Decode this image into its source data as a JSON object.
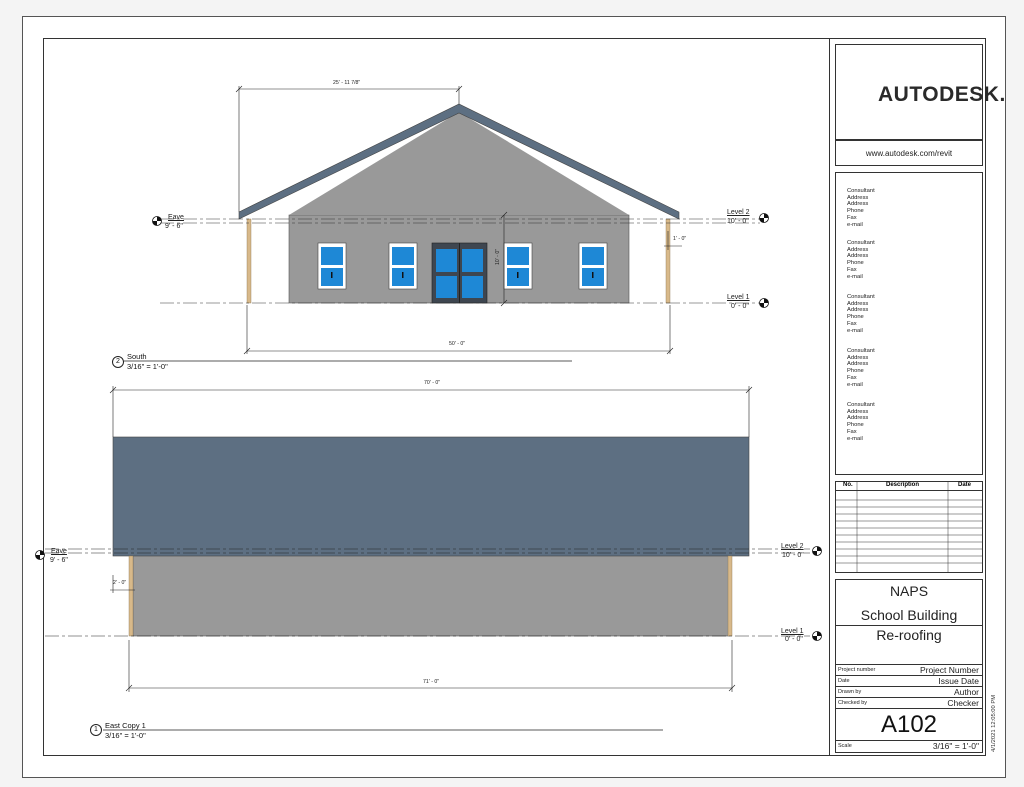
{
  "titleblock": {
    "logo_text": "AUTODESK.",
    "url": "www.autodesk.com/revit",
    "consultants": [
      [
        "Consultant",
        "Address",
        "Address",
        "Phone",
        "Fax",
        "e-mail"
      ],
      [
        "Consultant",
        "Address",
        "Address",
        "Phone",
        "Fax",
        "e-mail"
      ],
      [
        "Consultant",
        "Address",
        "Address",
        "Phone",
        "Fax",
        "e-mail"
      ],
      [
        "Consultant",
        "Address",
        "Address",
        "Phone",
        "Fax",
        "e-mail"
      ],
      [
        "Consultant",
        "Address",
        "Address",
        "Phone",
        "Fax",
        "e-mail"
      ]
    ],
    "revision_headers": {
      "no": "No.",
      "description": "Description",
      "date": "Date"
    },
    "project_client": "NAPS",
    "project_name_1": "School Building",
    "project_name_2": "Re-roofing",
    "meta": {
      "project_number_label": "Project number",
      "project_number": "Project Number",
      "date_label": "Date",
      "date": "Issue Date",
      "drawn_by_label": "Drawn by",
      "drawn_by": "Author",
      "checked_by_label": "Checked by",
      "checked_by": "Checker"
    },
    "sheet_number": "A102",
    "scale_label": "Scale",
    "scale": "3/16\" = 1'-0\"",
    "timestamp": "4/1/2021 12:05:00 PM"
  },
  "view_south": {
    "number": "2",
    "name": "South",
    "scale": "3/16\" = 1'-0\"",
    "dim_top": "25' - 11 7/8\"",
    "dim_bottom": "50' - 0\"",
    "dim_vertical": "10' - 0\"",
    "dim_eave": "1' - 0\"",
    "eave_name": "Eave",
    "eave_elev": "9' - 6\"",
    "level2_name": "Level 2",
    "level2_elev": "10' - 0\"",
    "level1_name": "Level 1",
    "level1_elev": "0' - 0\""
  },
  "view_east": {
    "number": "1",
    "name": "East Copy 1",
    "scale": "3/16\" = 1'-0\"",
    "dim_top": "70' - 0\"",
    "dim_bottom": "71' - 0\"",
    "dim_eave": "2' - 0\"",
    "eave_name": "Eave",
    "eave_elev": "9' - 6\"",
    "level2_name": "Level 2",
    "level2_elev": "10' - 0\"",
    "level1_name": "Level 1",
    "level1_elev": "0' - 0\""
  },
  "colors": {
    "roof": "#5d6f82",
    "wall": "#999999",
    "glass": "#1e88d6",
    "post": "#d8b98a"
  }
}
